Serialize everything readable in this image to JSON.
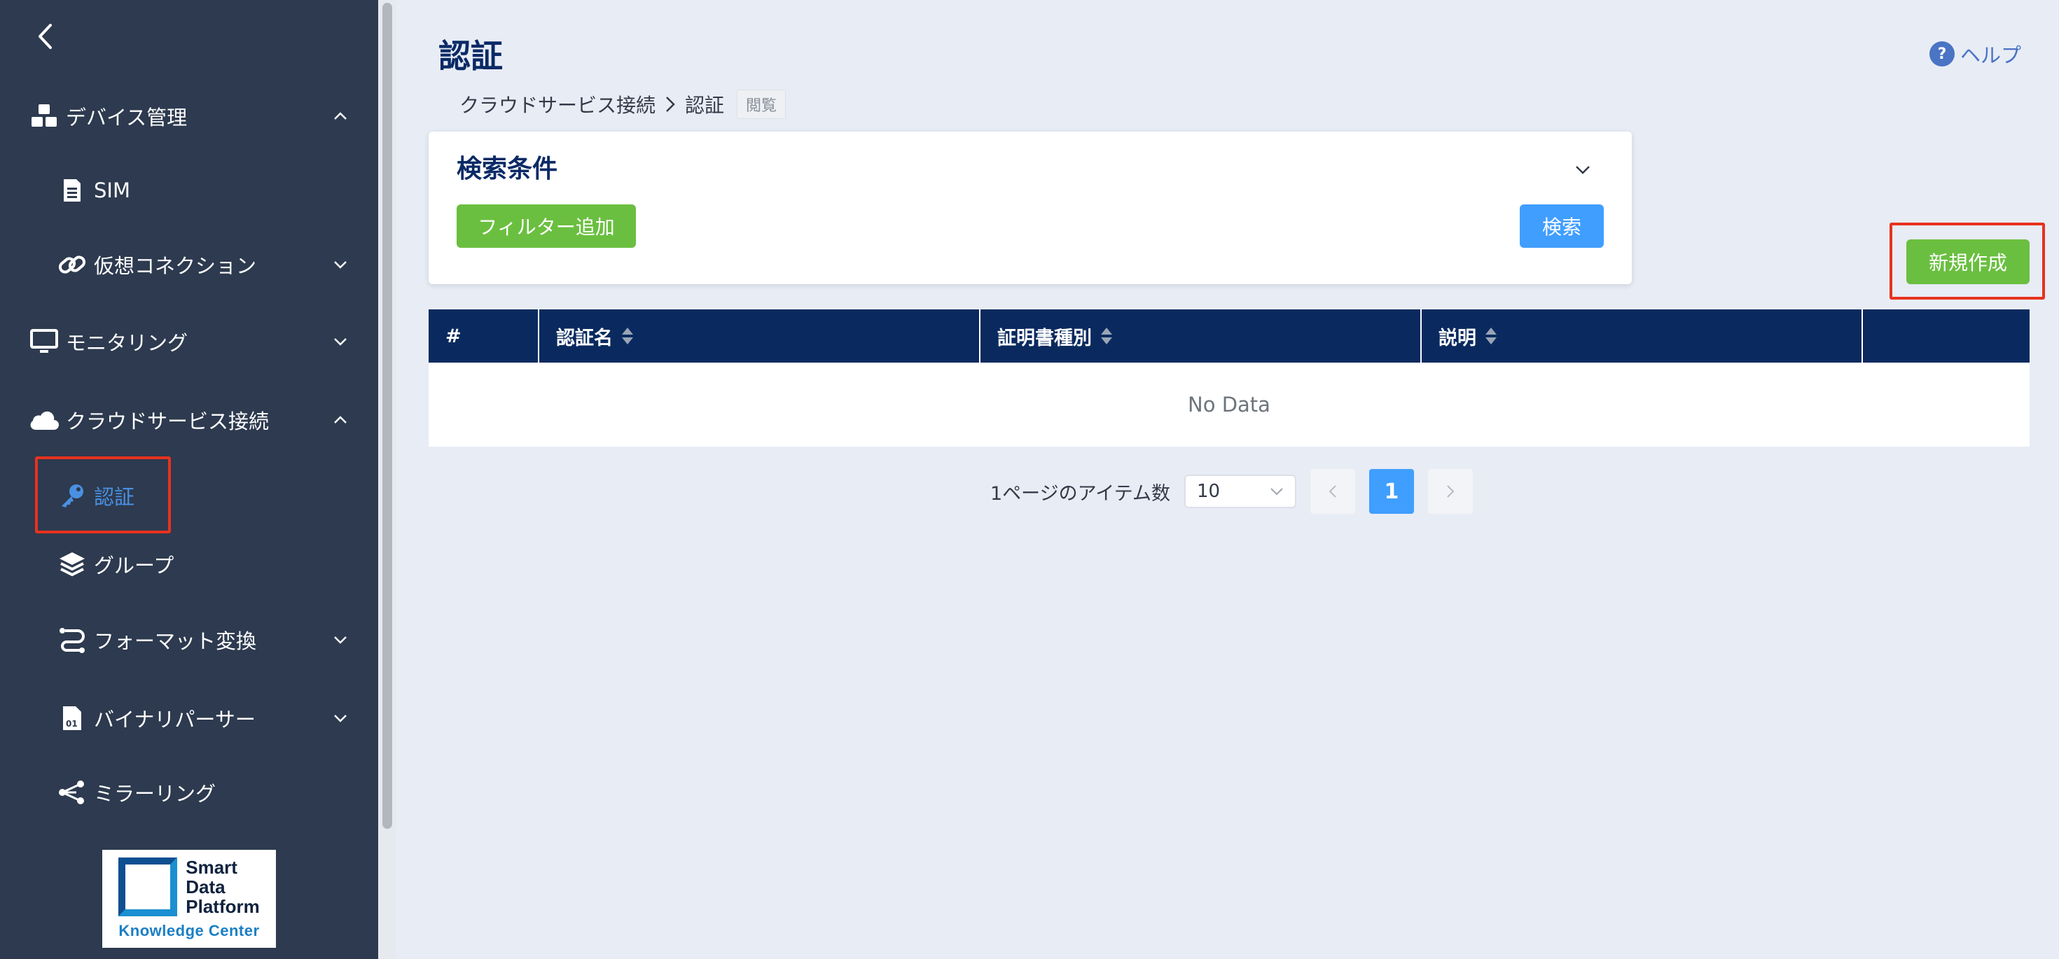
{
  "sidebar": {
    "items": [
      {
        "label": "デバイス管理",
        "icon": "cubes-icon"
      },
      {
        "label": "SIM",
        "icon": "sim-card-icon"
      },
      {
        "label": "仮想コネクション",
        "icon": "link-icon"
      },
      {
        "label": "モニタリング",
        "icon": "monitor-icon"
      },
      {
        "label": "クラウドサービス接続",
        "icon": "cloud-icon"
      },
      {
        "label": "認証",
        "icon": "key-icon"
      },
      {
        "label": "グループ",
        "icon": "layers-icon"
      },
      {
        "label": "フォーマット変換",
        "icon": "format-convert-icon"
      },
      {
        "label": "バイナリパーサー",
        "icon": "binary-file-icon"
      },
      {
        "label": "ミラーリング",
        "icon": "share-icon"
      }
    ],
    "logo": {
      "line1": "Smart",
      "line2": "Data",
      "line3": "Platform",
      "subtitle": "Knowledge Center"
    }
  },
  "header": {
    "title": "認証",
    "help_label": "ヘルプ"
  },
  "breadcrumb": {
    "parent": "クラウドサービス接続",
    "current": "認証",
    "badge": "閲覧"
  },
  "search": {
    "title": "検索条件",
    "add_filter_label": "フィルター追加",
    "search_label": "検索"
  },
  "actions": {
    "create_label": "新規作成"
  },
  "table": {
    "columns": [
      "#",
      "認証名",
      "証明書種別",
      "説明",
      ""
    ],
    "empty_text": "No Data"
  },
  "pagination": {
    "items_per_page_label": "1ページのアイテム数",
    "page_size": "10",
    "current_page": "1"
  },
  "colors": {
    "sidebar_bg": "#2d3a4f",
    "header_bg": "#0a2a5f",
    "accent_green": "#6abf40",
    "accent_blue": "#409eff",
    "highlight_red": "#e8321e"
  }
}
